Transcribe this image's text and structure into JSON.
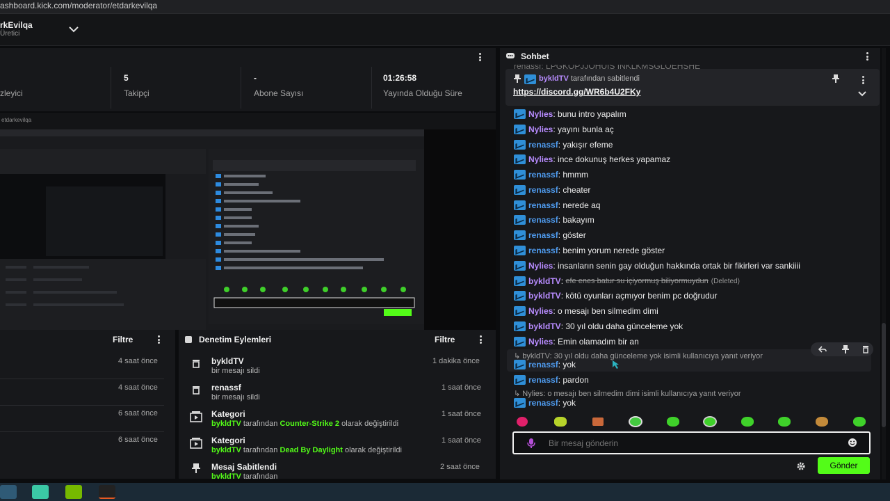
{
  "browser": {
    "url": "ashboard.kick.com/moderator/etdarkevilqa"
  },
  "channel": {
    "name": "rkEvilqa",
    "role": "Üretici"
  },
  "stats": [
    {
      "value": "",
      "label": "zleyici"
    },
    {
      "value": "5",
      "label": "Takipçi"
    },
    {
      "value": "-",
      "label": "Abone Sayısı"
    },
    {
      "value": "01:26:58",
      "label": "Yayında Olduğu Süre"
    }
  ],
  "stream": {
    "bar_text": "etdarkevilqa"
  },
  "left_panel": {
    "filter_label": "Filtre",
    "times": [
      "4 saat önce",
      "4 saat önce",
      "6 saat önce",
      "6 saat önce"
    ]
  },
  "actions_panel": {
    "title": "Denetim Eylemleri",
    "filter_label": "Filtre",
    "items": [
      {
        "icon": "trash-icon",
        "title": "byk­ldTV",
        "sub_plain": "bir mesajı sildi",
        "time": "1 dakika önce"
      },
      {
        "icon": "trash-icon",
        "title": "renassf",
        "sub_plain": "bir mesajı sildi",
        "time": "1 saat önce"
      },
      {
        "icon": "category-icon",
        "title": "Kategori",
        "sub_user": "bykldTV",
        "sub_mid": " tarafından ",
        "sub_green": "Counter-Strike 2",
        "sub_end": " olarak değiştirildi",
        "time": "1 saat önce"
      },
      {
        "icon": "category-icon",
        "title": "Kategori",
        "sub_user": "bykldTV",
        "sub_mid": " tarafından ",
        "sub_green": "Dead By Daylight",
        "sub_end": " olarak değiştirildi",
        "time": "1 saat önce"
      },
      {
        "icon": "pin-icon",
        "title": "Mesaj Sabitlendi",
        "sub_user": "bykldTV",
        "sub_mid": " tarafından",
        "sub_green": "",
        "sub_end": "",
        "time": "2 saat önce"
      }
    ]
  },
  "chat": {
    "title": "Sohbet",
    "top_cut": "renassf: LPGKOPJJOHUIS INKLKMSGLOEHSHE",
    "pinned": {
      "by_user": "bykldTV",
      "by_text": "tarafından sabitlendi",
      "link": "https://discord.gg/WR6b4U2FKy"
    },
    "messages": [
      {
        "user": "Nylies",
        "color": "purple",
        "text": "bunu intro yapalım"
      },
      {
        "user": "Nylies",
        "color": "purple",
        "text": "yayını bunla aç"
      },
      {
        "user": "renassf",
        "color": "blue",
        "text": "yakışır efeme"
      },
      {
        "user": "Nylies",
        "color": "purple",
        "text": "ince dokunuş herkes yapamaz"
      },
      {
        "user": "renassf",
        "color": "blue",
        "text": "hmmm"
      },
      {
        "user": "renassf",
        "color": "blue",
        "text": "cheater"
      },
      {
        "user": "renassf",
        "color": "blue",
        "text": "nerede aq"
      },
      {
        "user": "renassf",
        "color": "blue",
        "text": "bakayım"
      },
      {
        "user": "renassf",
        "color": "blue",
        "text": "göster"
      },
      {
        "user": "renassf",
        "color": "blue",
        "text": "benim yorum nerede göster"
      },
      {
        "user": "Nylies",
        "color": "purple",
        "text": "insanların senin gay olduğun hakkında ortak bir fikirleri var sankiiii"
      },
      {
        "user": "bykldTV",
        "color": "purple",
        "text": "efe enes batur su içiyormuş biliyormuydun",
        "deleted": "(Deleted)"
      },
      {
        "user": "bykldTV",
        "color": "purple",
        "text": "kötü oyunları açmıyor benim pc doğrudur"
      },
      {
        "user": "Nylies",
        "color": "purple",
        "text": "o mesajı ben silmedim dimi"
      },
      {
        "user": "bykldTV",
        "color": "purple",
        "text": "30 yıl oldu daha günceleme yok"
      },
      {
        "user": "Nylies",
        "color": "purple",
        "text": "Emin olamadım bir an"
      }
    ],
    "reply1": "bykldTV: 30 yıl oldu daha günceleme yok isimli kullanıcıya yanıt veriyor",
    "reply1_msg": {
      "user": "renassf",
      "text": "yok"
    },
    "msg_after": {
      "user": "renassf",
      "text": "pardon"
    },
    "reply2": "Nylies: o mesajı ben silmedim dimi isimli kullanıcıya yanıt veriyor",
    "reply2_msg": {
      "user": "renassf",
      "text": "yok"
    },
    "input_placeholder": "Bir mesaj gönderin",
    "send_label": "Gönder"
  },
  "colors": {
    "accent": "#53fc18",
    "bg": "#0b0c0e",
    "panel": "#17181b"
  }
}
